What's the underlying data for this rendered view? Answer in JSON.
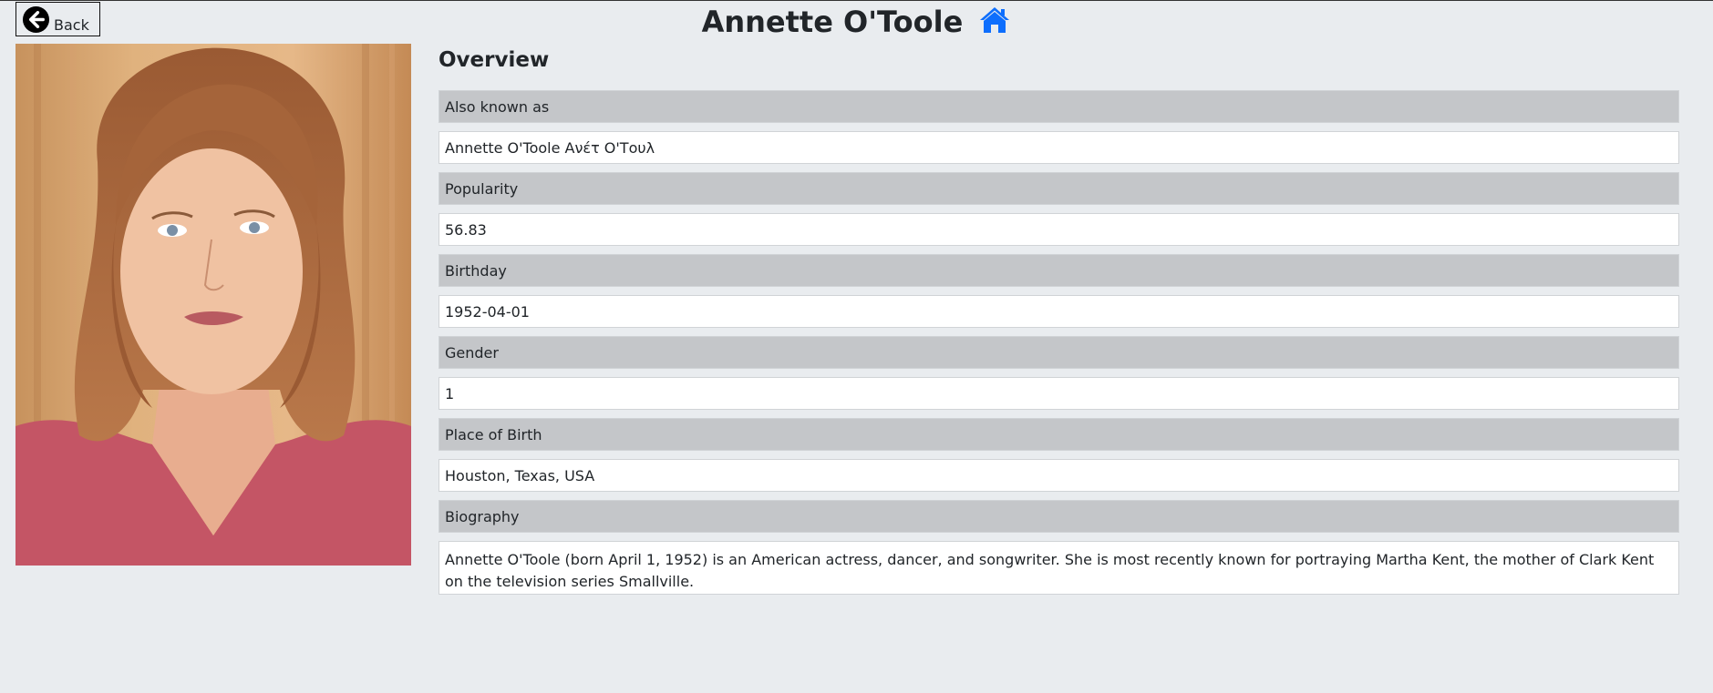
{
  "nav": {
    "back_label": "Back"
  },
  "header": {
    "title": "Annette O'Toole"
  },
  "overview": {
    "title": "Overview",
    "fields": [
      {
        "label": "Also known as",
        "value": "Annette O'Toole Ανέτ Ο'Τουλ"
      },
      {
        "label": "Popularity",
        "value": "56.83"
      },
      {
        "label": "Birthday",
        "value": "1952-04-01"
      },
      {
        "label": "Gender",
        "value": "1"
      },
      {
        "label": "Place of Birth",
        "value": "Houston, Texas, USA"
      },
      {
        "label": "Biography",
        "value": "Annette O'Toole (born April 1, 1952) is an American actress, dancer, and songwriter. She is most recently known for portraying Martha Kent, the mother of Clark Kent on the television series Smallville."
      }
    ]
  },
  "icons": {
    "back": "arrow-circle-left-icon",
    "home": "home-icon"
  },
  "colors": {
    "home_icon": "#0d6efd",
    "label_bg": "#c4c6c9",
    "page_bg": "#e9ecef"
  }
}
